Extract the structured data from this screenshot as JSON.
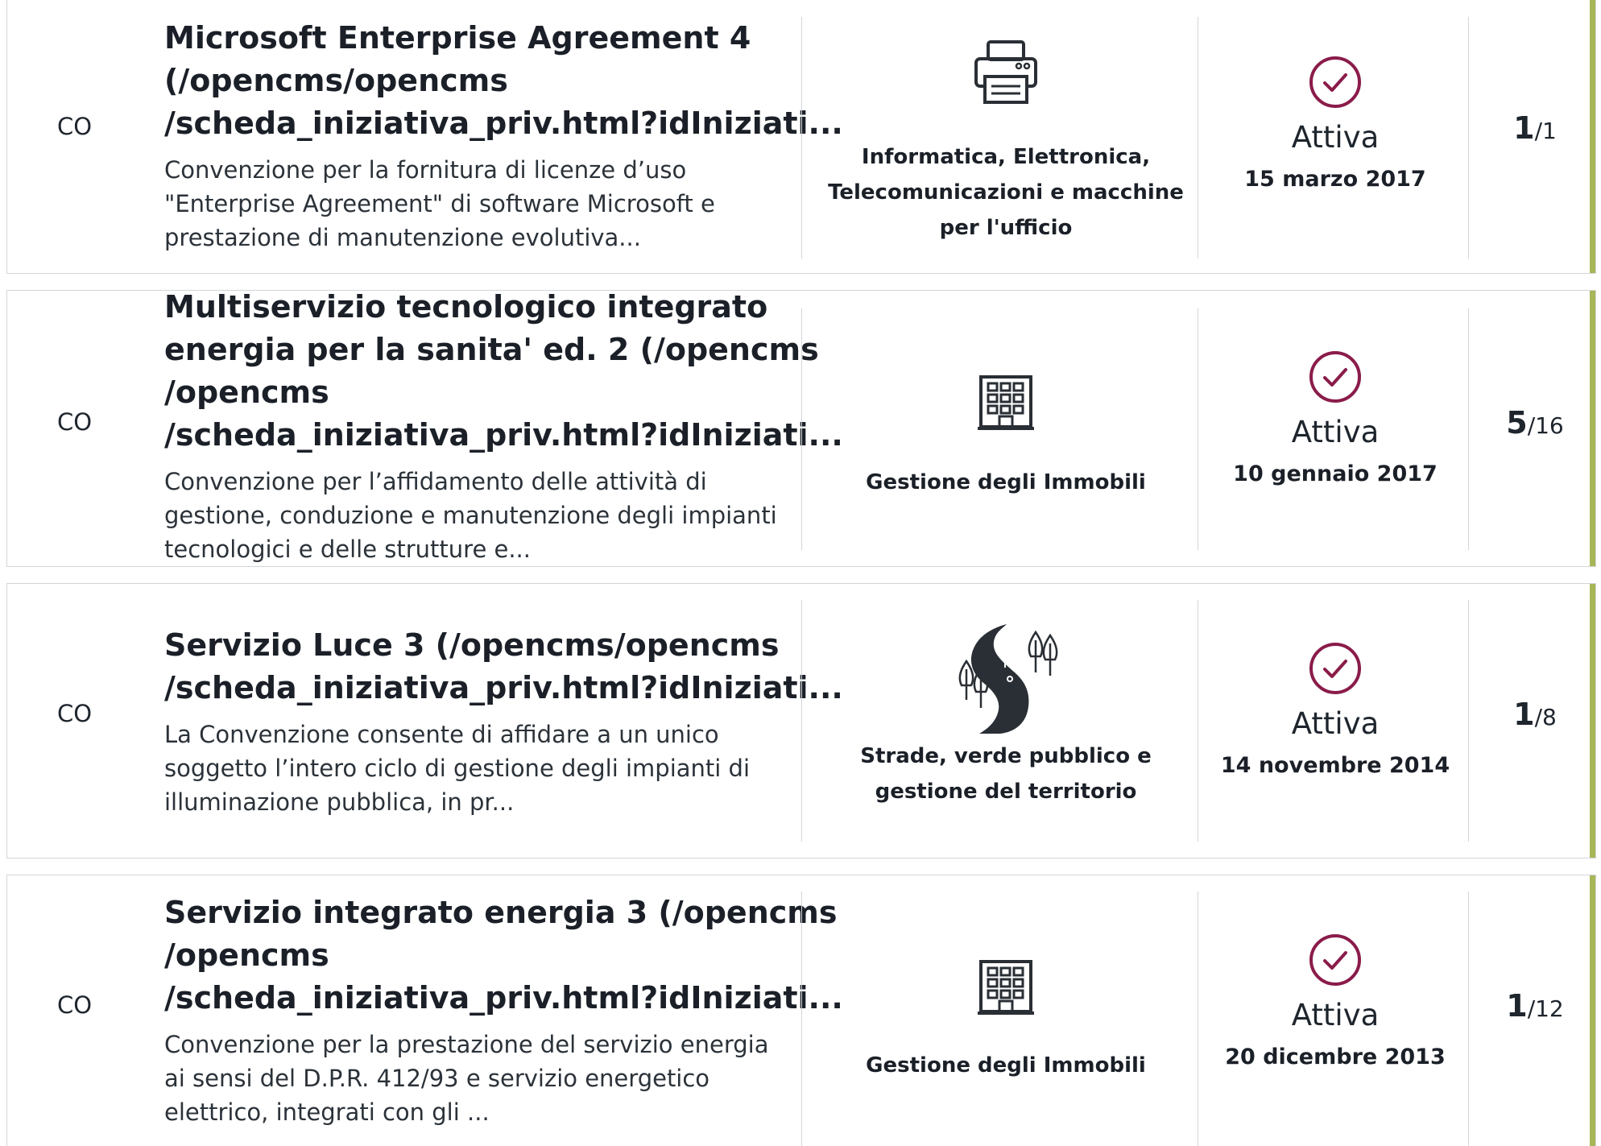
{
  "colors": {
    "accent_bar": "#a7b657",
    "status_icon": "#8a1c4a",
    "border": "#d2d6da",
    "icon_dark": "#2a2f35"
  },
  "rows": [
    {
      "type": "CO",
      "title_lines": [
        "Microsoft Enterprise Agreement 4",
        "(/opencms/opencms",
        "/scheda_iniziativa_priv.html?idIniziati..."
      ],
      "desc_lines": [
        "Convenzione per la fornitura di licenze d’uso",
        "\"Enterprise Agreement\" di software Microsoft e",
        "prestazione di manutenzione evolutiva..."
      ],
      "category_icon": "printer-icon",
      "category_lines": [
        "Informatica, Elettronica,",
        "Telecomunicazioni e macchine",
        "per l'ufficio"
      ],
      "status": "Attiva",
      "status_icon": "check-circle-icon",
      "date": "15 marzo 2017",
      "count_num": "1",
      "count_total": "/1"
    },
    {
      "type": "CO",
      "title_lines": [
        "Multiservizio tecnologico integrato",
        "energia per la sanita' ed. 2 (/opencms",
        "/opencms",
        "/scheda_iniziativa_priv.html?idIniziati..."
      ],
      "desc_lines": [
        "Convenzione per l’affidamento delle attività di",
        "gestione, conduzione e manutenzione degli impianti",
        "tecnologici e delle strutture e..."
      ],
      "category_icon": "building-icon",
      "category_lines": [
        "Gestione degli Immobili"
      ],
      "status": "Attiva",
      "status_icon": "check-circle-icon",
      "date": "10 gennaio 2017",
      "count_num": "5",
      "count_total": "/16"
    },
    {
      "type": "CO",
      "title_lines": [
        "Servizio Luce 3 (/opencms/opencms",
        "/scheda_iniziativa_priv.html?idIniziati..."
      ],
      "desc_lines": [
        "La Convenzione consente di affidare a un unico",
        "soggetto l’intero ciclo di gestione degli impianti di",
        "illuminazione pubblica, in pr..."
      ],
      "category_icon": "road-trees-icon",
      "category_lines": [
        "Strade, verde pubblico e",
        "gestione del territorio"
      ],
      "status": "Attiva",
      "status_icon": "check-circle-icon",
      "date": "14 novembre 2014",
      "count_num": "1",
      "count_total": "/8"
    },
    {
      "type": "CO",
      "title_lines": [
        "Servizio integrato energia 3 (/opencms",
        "/opencms",
        "/scheda_iniziativa_priv.html?idIniziati..."
      ],
      "desc_lines": [
        "Convenzione per la prestazione del servizio energia",
        "ai sensi del D.P.R. 412/93 e servizio energetico",
        "elettrico, integrati con gli ..."
      ],
      "category_icon": "building-icon",
      "category_lines": [
        "Gestione degli Immobili"
      ],
      "status": "Attiva",
      "status_icon": "check-circle-icon",
      "date": "20 dicembre 2013",
      "count_num": "1",
      "count_total": "/12"
    }
  ]
}
